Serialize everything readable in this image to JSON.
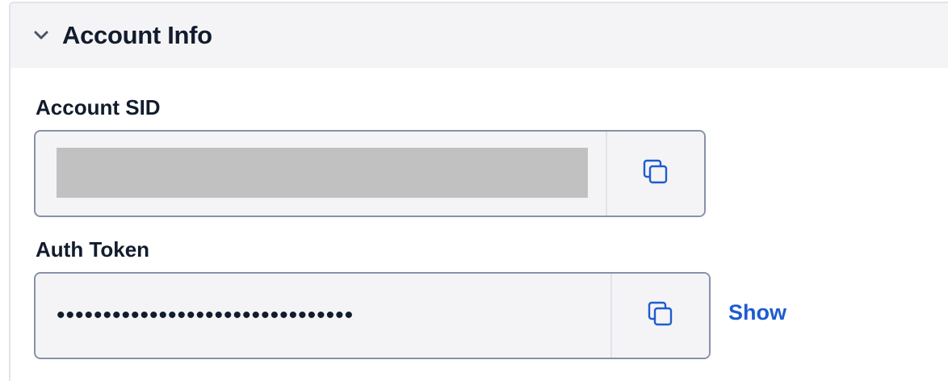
{
  "section": {
    "title": "Account Info"
  },
  "account_sid": {
    "label": "Account SID",
    "value": "",
    "copy_icon": "copy-icon"
  },
  "auth_token": {
    "label": "Auth Token",
    "value": "••••••••••••••••••••••••••••••••",
    "copy_icon": "copy-icon",
    "show_label": "Show"
  },
  "colors": {
    "header_bg": "#f4f4f6",
    "field_bg": "#f4f4f6",
    "field_border": "#8891aa",
    "link": "#1f5bd0",
    "text": "#121c2d"
  }
}
